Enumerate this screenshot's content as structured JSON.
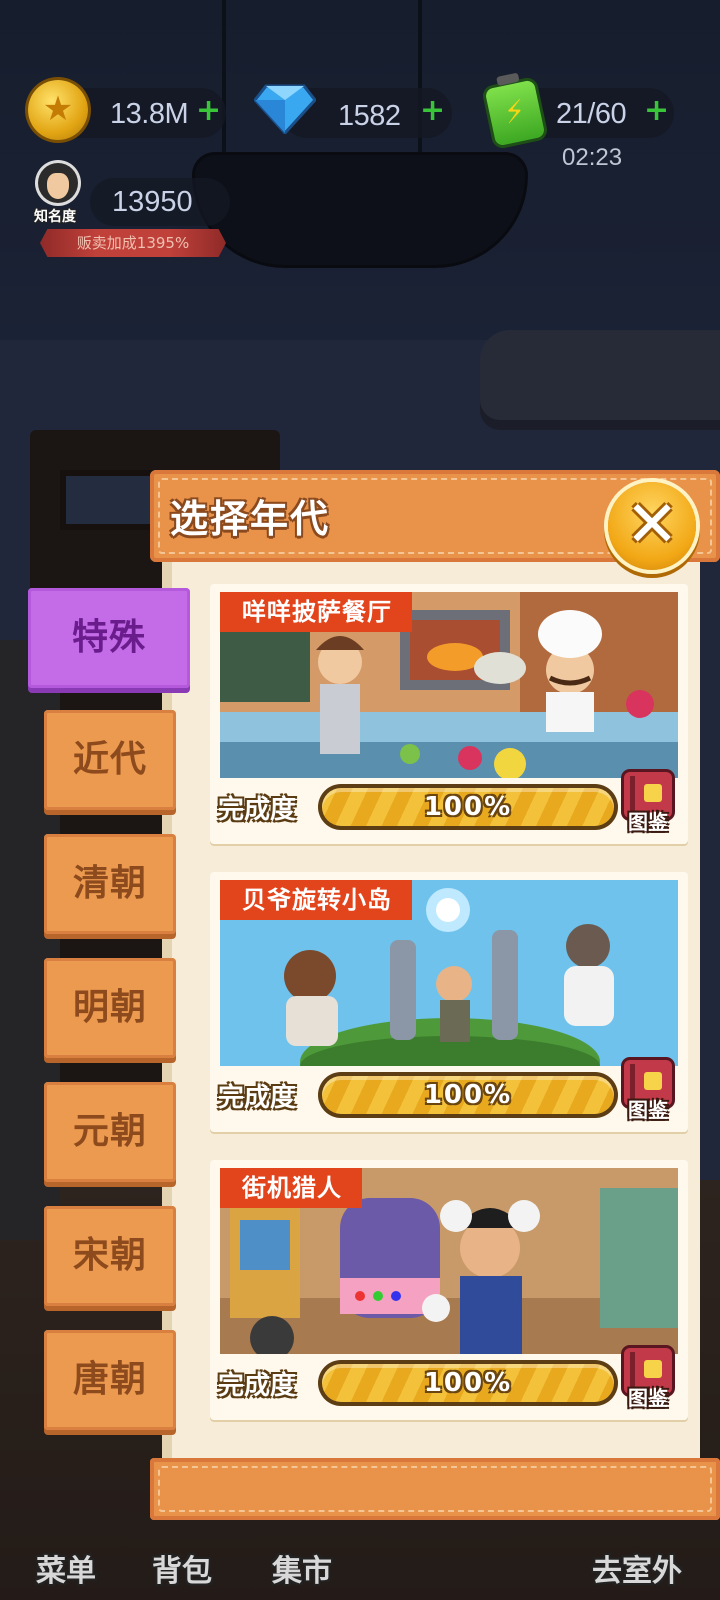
{
  "hud": {
    "coins": "13.8M",
    "gems": "1582",
    "energy": "21/60",
    "energy_timer": "02:23",
    "plus": "+"
  },
  "fame": {
    "label": "知名度",
    "value": "13950",
    "bonus": "贩卖加成1395%"
  },
  "panel": {
    "title": "选择年代",
    "close": "✕"
  },
  "eras": [
    {
      "label": "特殊",
      "active": true
    },
    {
      "label": "近代"
    },
    {
      "label": "清朝"
    },
    {
      "label": "明朝"
    },
    {
      "label": "元朝"
    },
    {
      "label": "宋朝"
    },
    {
      "label": "唐朝"
    }
  ],
  "cards": [
    {
      "title": "咩咩披萨餐厅",
      "progress_label": "完成度",
      "progress": "100%",
      "progress_fraction": 1.0,
      "codex": "图鉴"
    },
    {
      "title": "贝爷旋转小岛",
      "progress_label": "完成度",
      "progress": "100%",
      "progress_fraction": 1.0,
      "codex": "图鉴"
    },
    {
      "title": "街机猎人",
      "progress_label": "完成度",
      "progress": "100%",
      "progress_fraction": 1.0,
      "codex": "图鉴"
    }
  ],
  "bottom_nav": {
    "menu": "菜单",
    "bag": "背包",
    "market": "集市",
    "outdoor": "去室外"
  },
  "colors": {
    "panel_orange": "#e8924a",
    "tab_active": "#c46ce8",
    "banner_red": "#e2441c",
    "progress_yellow": "#f3c23a"
  }
}
